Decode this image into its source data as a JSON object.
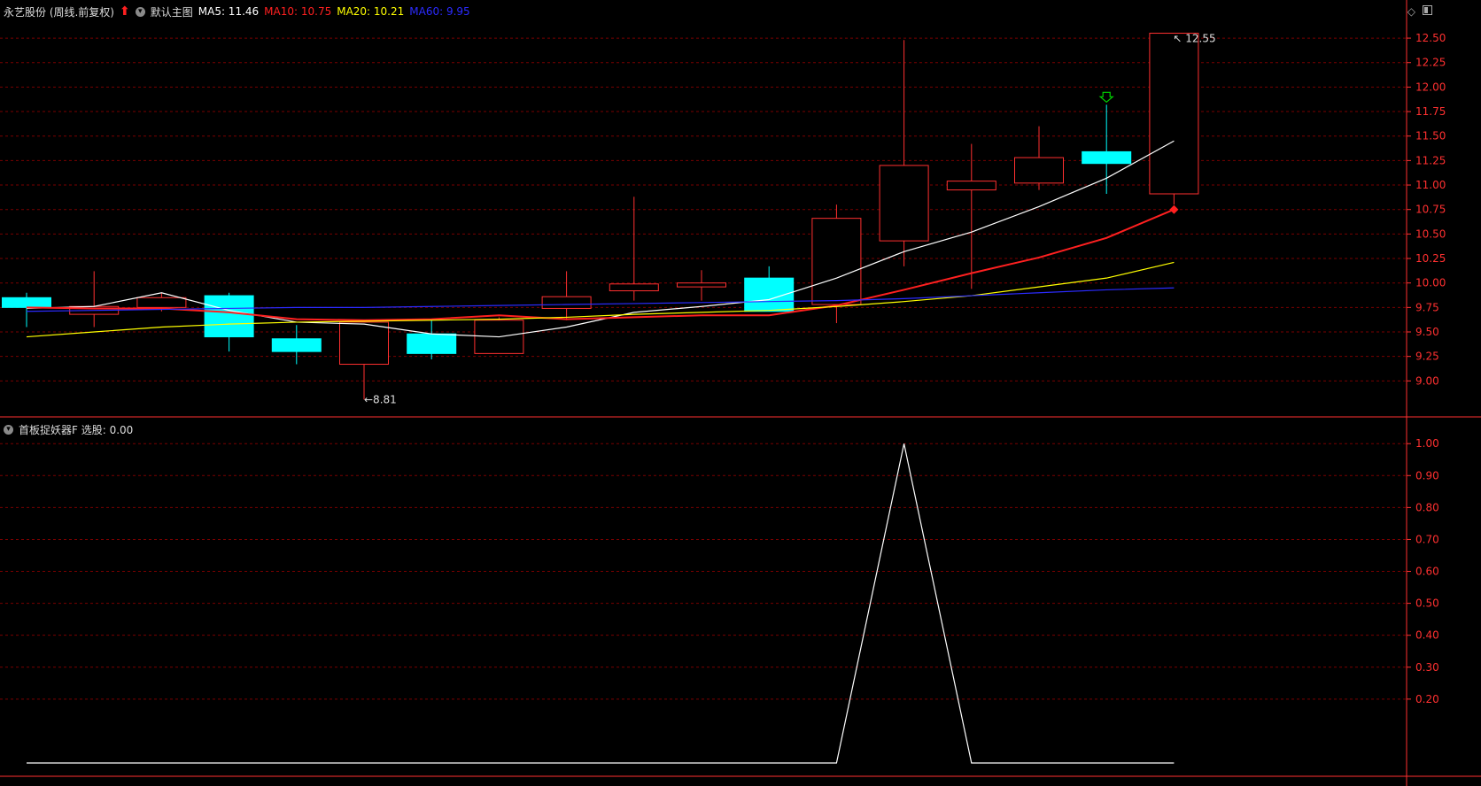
{
  "header": {
    "stock_title": "永艺股份 (周线.前复权)",
    "template_label": "默认主图",
    "ma5": {
      "label": "MA5: 11.46",
      "color": "#ffffff"
    },
    "ma10": {
      "label": "MA10: 10.75",
      "color": "#ff2020"
    },
    "ma20": {
      "label": "MA20: 10.21",
      "color": "#ffff00"
    },
    "ma60": {
      "label": "MA60: 9.95",
      "color": "#2b2bff"
    }
  },
  "indicator_header": {
    "label": "首板捉妖器F 选股: 0.00"
  },
  "colors": {
    "up": "#ff3030",
    "down": "#00ffff",
    "grid": "#7a0000",
    "axis_text": "#ff3030",
    "indicator_line": "#ffffff"
  },
  "chart_data": [
    {
      "type": "candlestick",
      "period": "weekly",
      "ylim": [
        8.75,
        12.6
      ],
      "yticks": [
        "9.00",
        "9.25",
        "9.50",
        "9.75",
        "10.00",
        "10.25",
        "10.50",
        "10.75",
        "11.00",
        "11.25",
        "11.50",
        "11.75",
        "12.00",
        "12.25",
        "12.50"
      ],
      "candles": [
        {
          "open": 9.85,
          "close": 9.75,
          "high": 9.9,
          "low": 9.55
        },
        {
          "open": 9.68,
          "close": 9.76,
          "high": 10.12,
          "low": 9.55
        },
        {
          "open": 9.75,
          "close": 9.85,
          "high": 9.9,
          "low": 9.71
        },
        {
          "open": 9.87,
          "close": 9.45,
          "high": 9.9,
          "low": 9.3
        },
        {
          "open": 9.43,
          "close": 9.3,
          "high": 9.57,
          "low": 9.17
        },
        {
          "open": 9.17,
          "close": 9.6,
          "high": 9.62,
          "low": 8.81
        },
        {
          "open": 9.48,
          "close": 9.28,
          "high": 9.62,
          "low": 9.22
        },
        {
          "open": 9.28,
          "close": 9.62,
          "high": 9.65,
          "low": 9.28
        },
        {
          "open": 9.74,
          "close": 9.86,
          "high": 10.12,
          "low": 9.62
        },
        {
          "open": 9.92,
          "close": 9.99,
          "high": 10.88,
          "low": 9.82
        },
        {
          "open": 9.96,
          "close": 10.0,
          "high": 10.13,
          "low": 9.82
        },
        {
          "open": 10.05,
          "close": 9.71,
          "high": 10.17,
          "low": 9.71
        },
        {
          "open": 9.78,
          "close": 10.66,
          "high": 10.8,
          "low": 9.59
        },
        {
          "open": 10.43,
          "close": 11.2,
          "high": 12.48,
          "low": 10.17
        },
        {
          "open": 10.95,
          "close": 11.04,
          "high": 11.42,
          "low": 9.94
        },
        {
          "open": 11.02,
          "close": 11.28,
          "high": 11.6,
          "low": 10.95
        },
        {
          "open": 11.34,
          "close": 11.22,
          "high": 11.82,
          "low": 10.91
        },
        {
          "open": 10.91,
          "close": 12.55,
          "high": 12.55,
          "low": 10.8
        }
      ],
      "annotations": {
        "low": "8.81",
        "high": "12.55"
      },
      "series": [
        {
          "name": "MA5",
          "values": [
            9.74,
            9.76,
            9.9,
            9.72,
            9.6,
            9.58,
            9.48,
            9.45,
            9.55,
            9.7,
            9.76,
            9.83,
            10.05,
            10.32,
            10.52,
            10.78,
            11.07,
            11.45
          ]
        },
        {
          "name": "MA10",
          "values": [
            9.75,
            9.74,
            9.74,
            9.7,
            9.63,
            9.62,
            9.63,
            9.67,
            9.63,
            9.65,
            9.67,
            9.67,
            9.77,
            9.93,
            10.1,
            10.26,
            10.46,
            10.75
          ]
        },
        {
          "name": "MA20",
          "values": [
            9.45,
            9.5,
            9.55,
            9.58,
            9.6,
            9.61,
            9.62,
            9.63,
            9.65,
            9.68,
            9.7,
            9.72,
            9.76,
            9.81,
            9.87,
            9.96,
            10.05,
            10.21
          ]
        },
        {
          "name": "MA60",
          "values": [
            9.71,
            9.72,
            9.73,
            9.74,
            9.75,
            9.75,
            9.76,
            9.77,
            9.78,
            9.79,
            9.8,
            9.81,
            9.82,
            9.84,
            9.87,
            9.9,
            9.93,
            9.95
          ]
        }
      ]
    },
    {
      "type": "line",
      "ylim": [
        0.0,
        1.02
      ],
      "yticks": [
        "0.20",
        "0.30",
        "0.40",
        "0.50",
        "0.60",
        "0.70",
        "0.80",
        "0.90",
        "1.00"
      ],
      "series": [
        {
          "name": "选股",
          "values": [
            0,
            0,
            0,
            0,
            0,
            0,
            0,
            0,
            0,
            0,
            0,
            0,
            0,
            1,
            0,
            0,
            0,
            0
          ]
        }
      ]
    }
  ]
}
